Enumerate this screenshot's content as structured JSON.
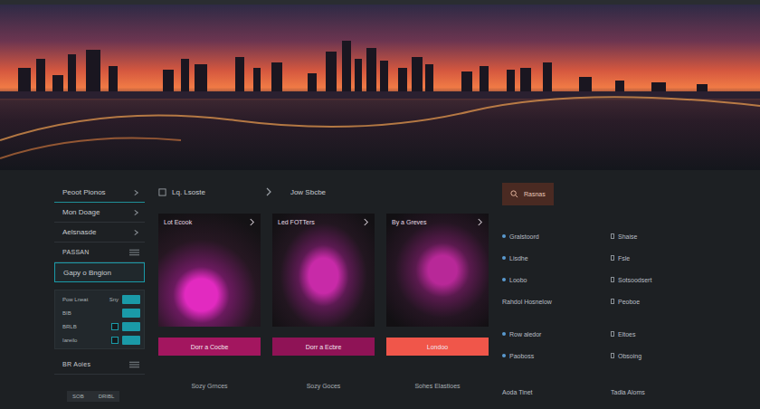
{
  "sidebar": {
    "items": [
      {
        "label": "Peoot Pionos",
        "kind": "link",
        "selected": false
      },
      {
        "label": "Mon Doage",
        "kind": "link",
        "selected": false
      },
      {
        "label": "Aelsnasde",
        "kind": "link",
        "selected": false
      },
      {
        "label": "PASSAN",
        "kind": "section",
        "selected": false
      },
      {
        "label": "Gapy o Bngion",
        "kind": "option",
        "selected": true
      }
    ],
    "toggle_panel": {
      "header": {
        "label": "Pow Lneat",
        "tag": "Sny",
        "on": true
      },
      "rows": [
        {
          "label": "BIB",
          "kind": "toggle",
          "checked": false,
          "on": true
        },
        {
          "label": "BRLB",
          "kind": "check-toggle",
          "checked": false,
          "on": true
        },
        {
          "label": "Iareilo",
          "kind": "check-toggle",
          "checked": false,
          "on": true
        }
      ]
    },
    "footer_item": {
      "label": "BR Aoies"
    },
    "footer_buttons": [
      "SOB",
      "DRIBL"
    ]
  },
  "center": {
    "tabs": [
      {
        "label": "Lq. Lsoste"
      },
      {
        "label": "Jow Sbcbe"
      }
    ],
    "cards": [
      {
        "title": "Lot Ecook",
        "button": "Dorr a Cocbe",
        "color": "#a3165f",
        "caption": "Sozy Grnces"
      },
      {
        "title": "Led FOTTers",
        "button": "Dorr a Ecbre",
        "color": "#8f1356",
        "caption": "Sozy Goces"
      },
      {
        "title": "By a Greves",
        "button": "Londoo",
        "color": "#f0564a",
        "caption": "Sohes Elastioes"
      }
    ]
  },
  "search_button": {
    "label": "Rasnas"
  },
  "links": {
    "groups": [
      [
        {
          "left": "Gralstoord",
          "left_marker": true,
          "right": "Shaise"
        },
        {
          "left": "Lisdhe",
          "left_marker": true,
          "right": "Fsle"
        },
        {
          "left": "Loobo",
          "left_marker": true,
          "right": "Sotsoodsert"
        },
        {
          "left": "Rahdol Hosnelow",
          "left_marker": false,
          "right": "Peoboe"
        }
      ],
      [
        {
          "left": "Row aledor",
          "left_marker": true,
          "right": "Eltoes"
        },
        {
          "left": "Paoboss",
          "left_marker": true,
          "right": "Obsoing"
        }
      ]
    ],
    "footer": {
      "left": "Aoda Tinet",
      "right": "Tadla Aloms"
    }
  }
}
